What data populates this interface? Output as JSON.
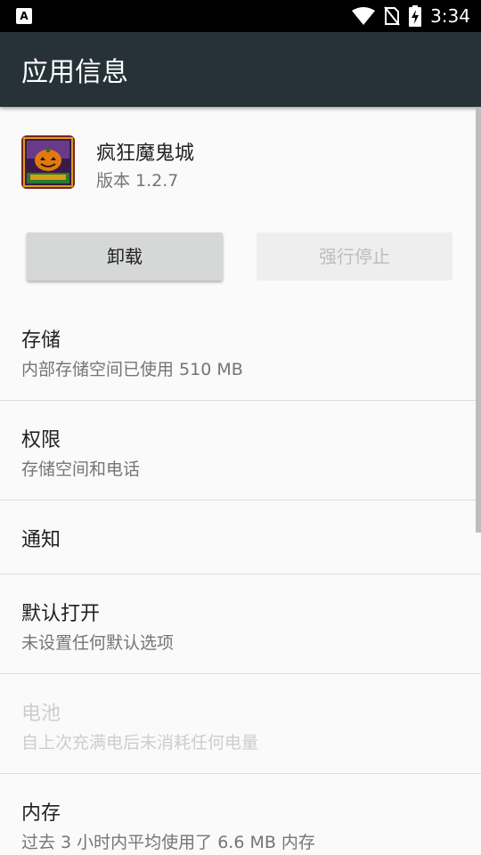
{
  "status_bar": {
    "time": "3:34",
    "left_icon_letter": "A",
    "icons": [
      "wifi-icon",
      "no-sim-icon",
      "battery-charging-icon"
    ]
  },
  "app_bar": {
    "title": "应用信息"
  },
  "app": {
    "name": "疯狂魔鬼城",
    "version": "版本 1.2.7"
  },
  "buttons": {
    "uninstall": "卸载",
    "force_stop": "强行停止"
  },
  "settings": [
    {
      "title": "存储",
      "summary": "内部存储空间已使用 510 MB",
      "enabled": true
    },
    {
      "title": "权限",
      "summary": "存储空间和电话",
      "enabled": true
    },
    {
      "title": "通知",
      "summary": "",
      "enabled": true
    },
    {
      "title": "默认打开",
      "summary": "未设置任何默认选项",
      "enabled": true
    },
    {
      "title": "电池",
      "summary": "自上次充满电后未消耗任何电量",
      "enabled": false
    },
    {
      "title": "内存",
      "summary": "过去 3 小时内平均使用了 6.6 MB 内存",
      "enabled": true
    }
  ],
  "colors": {
    "app_bar": "#263238",
    "status_bar": "#000000",
    "background": "#fafafa"
  }
}
